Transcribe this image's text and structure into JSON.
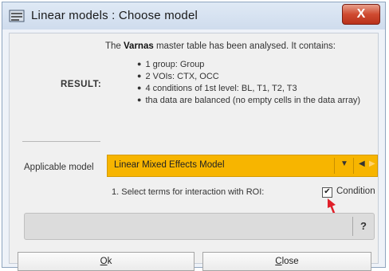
{
  "window": {
    "title": "Linear models : Choose model",
    "close_glyph": "X"
  },
  "intro": {
    "prefix": "The ",
    "table_name": "Varnas",
    "suffix": " master table has been analysed. It contains:"
  },
  "result": {
    "label": "RESULT:",
    "items": [
      "1 group: Group",
      "2 VOIs: CTX, OCC",
      "4 conditions of 1st level: BL, T1, T2, T3",
      "tha data are balanced (no empty cells in the data array)"
    ]
  },
  "model": {
    "label": "Applicable model",
    "selected": "Linear Mixed Effects Model"
  },
  "interaction": {
    "instruction": "1. Select terms for interaction with ROI:",
    "checkbox_label": "Condition",
    "checked": true
  },
  "help_label": "?",
  "buttons": {
    "ok_key": "O",
    "ok_rest": "k",
    "close_key": "C",
    "close_rest": "lose"
  },
  "colors": {
    "model_select_bg": "#f7b500",
    "arrow": "#e0202a"
  },
  "icons": [
    "app-icon",
    "close-icon",
    "dropdown-arrow-icon",
    "prev-arrow-icon",
    "next-arrow-icon",
    "check-icon",
    "red-arrow-icon",
    "help-icon"
  ]
}
